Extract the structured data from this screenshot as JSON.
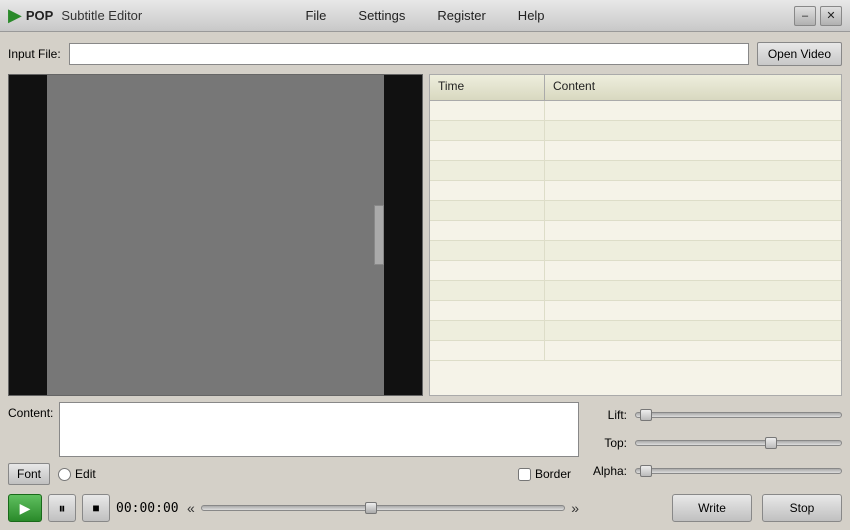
{
  "titlebar": {
    "app_icon": "▶",
    "app_name": "POP",
    "app_subtitle": "Subtitle Editor",
    "menus": [
      "File",
      "Settings",
      "Register",
      "Help"
    ],
    "minimize_label": "–",
    "close_label": "✕"
  },
  "input_file": {
    "label": "Input File:",
    "placeholder": "",
    "open_button": "Open Video"
  },
  "subtitle_table": {
    "col_time": "Time",
    "col_content": "Content",
    "rows": [
      {
        "time": "",
        "content": ""
      },
      {
        "time": "",
        "content": ""
      },
      {
        "time": "",
        "content": ""
      },
      {
        "time": "",
        "content": ""
      },
      {
        "time": "",
        "content": ""
      },
      {
        "time": "",
        "content": ""
      },
      {
        "time": "",
        "content": ""
      },
      {
        "time": "",
        "content": ""
      },
      {
        "time": "",
        "content": ""
      },
      {
        "time": "",
        "content": ""
      },
      {
        "time": "",
        "content": ""
      },
      {
        "time": "",
        "content": ""
      },
      {
        "time": "",
        "content": ""
      }
    ]
  },
  "content_editor": {
    "content_label": "Content:",
    "font_button": "Font",
    "edit_label": "Edit",
    "border_label": "Border"
  },
  "playback": {
    "time_display": "00:00:00",
    "play_icon": "▶",
    "pause_icon": "⏸",
    "stop_icon": "■",
    "seek_back_icon": "«",
    "seek_forward_icon": "»"
  },
  "sliders": {
    "lift_label": "Lift:",
    "top_label": "Top:",
    "alpha_label": "Alpha:",
    "lift_value": 0,
    "top_value": 65,
    "alpha_value": 0
  },
  "actions": {
    "write_label": "Write",
    "stop_label": "Stop"
  }
}
